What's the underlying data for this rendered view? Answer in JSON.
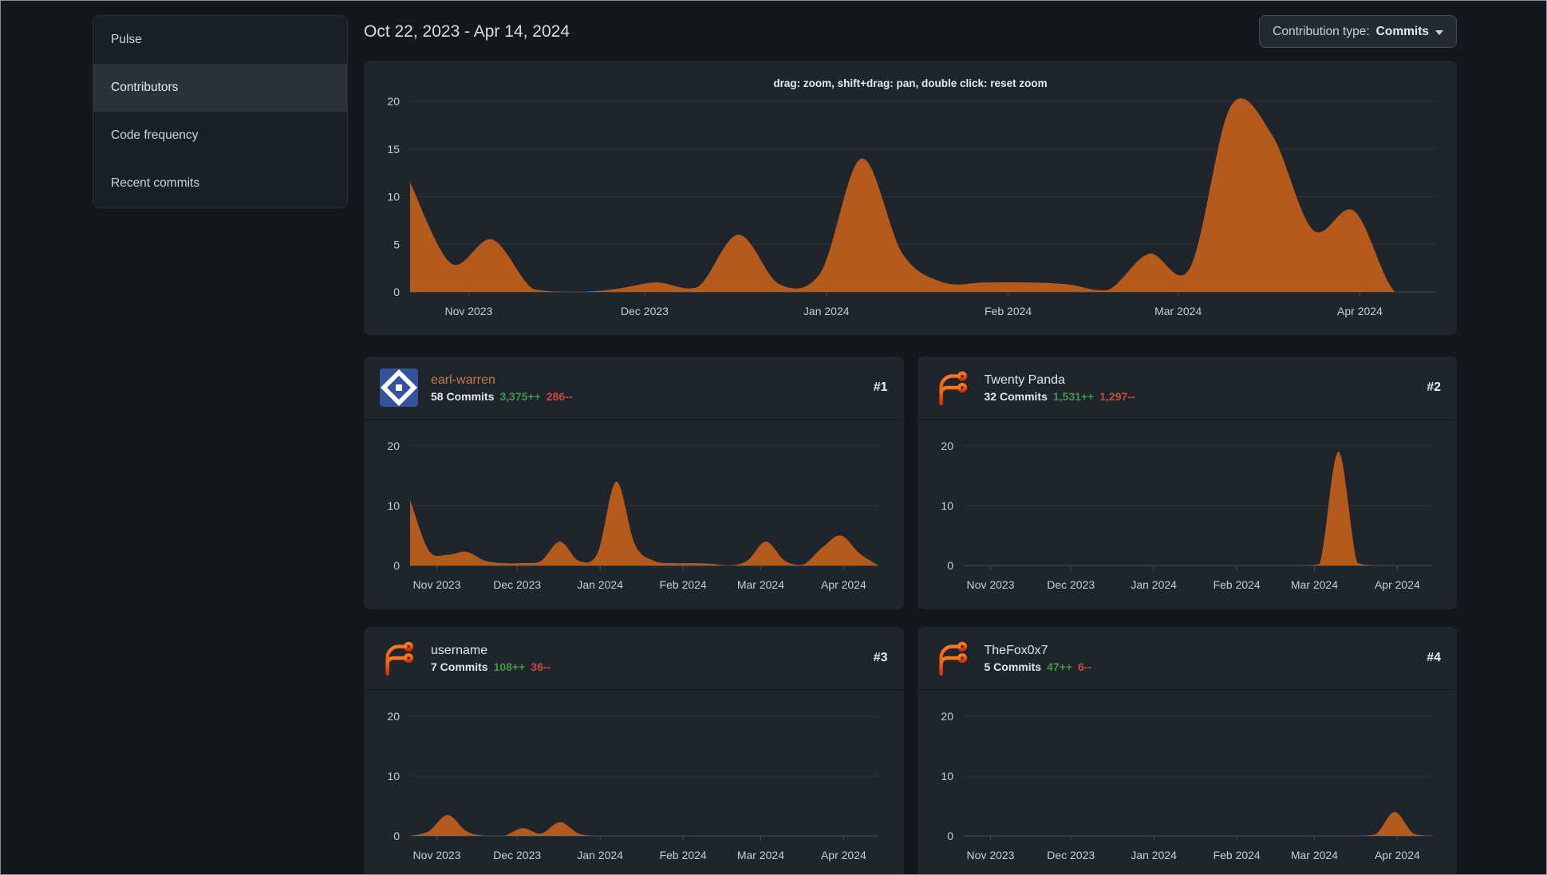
{
  "theme": {
    "page_bg": "#14171c",
    "panel_bg": "#191f26",
    "card_bg": "#1f252d",
    "selected_bg": "#2a323c",
    "border": "#262e38",
    "text": "#ccd3da",
    "heading_text": "#d6dce3",
    "area_fill": "#b45a1d",
    "grid_line": "#2c333c",
    "axis_line": "#434b55",
    "axis_text": "#c6cdd4",
    "additions_green": "#419744",
    "deletions_red": "#c7493f",
    "accent_orange_name": "#c87a41"
  },
  "sidebar": {
    "items": [
      {
        "label": "Pulse",
        "active": false
      },
      {
        "label": "Contributors",
        "active": true
      },
      {
        "label": "Code frequency",
        "active": false
      },
      {
        "label": "Recent commits",
        "active": false
      }
    ]
  },
  "header": {
    "date_range": "Oct 22, 2023 - Apr 14, 2024",
    "contribution_type_label": "Contribution type:",
    "contribution_type_value": "Commits"
  },
  "contributors": [
    {
      "name": "earl-warren",
      "commits": "58 Commits",
      "additions": "3,375++",
      "deletions": "286--",
      "rank": "#1",
      "avatar": "identicon-blue"
    },
    {
      "name": "Twenty Panda",
      "commits": "32 Commits",
      "additions": "1,531++",
      "deletions": "1,297--",
      "rank": "#2",
      "avatar": "forgejo-logo"
    },
    {
      "name": "username",
      "commits": "7 Commits",
      "additions": "108++",
      "deletions": "36--",
      "rank": "#3",
      "avatar": "forgejo-logo"
    },
    {
      "name": "TheFox0x7",
      "commits": "5 Commits",
      "additions": "47++",
      "deletions": "6--",
      "rank": "#4",
      "avatar": "forgejo-logo"
    }
  ],
  "chart_data": {
    "type": "area",
    "hint": "drag: zoom, shift+drag: pan, double click: reset zoom",
    "x_range_label": "Oct 22, 2023 - Apr 14, 2024",
    "point_interval": "weekly",
    "grid": true,
    "legend": false,
    "x_ticks": [
      {
        "frac": 0.0571,
        "label": "Nov 2023"
      },
      {
        "frac": 0.2286,
        "label": "Dec 2023"
      },
      {
        "frac": 0.4057,
        "label": "Jan 2024"
      },
      {
        "frac": 0.5829,
        "label": "Feb 2024"
      },
      {
        "frac": 0.7486,
        "label": "Mar 2024"
      },
      {
        "frac": 0.9257,
        "label": "Apr 2024"
      }
    ],
    "charts": [
      {
        "name": "overall-commits",
        "ylim": [
          0,
          20
        ],
        "yticks": [
          0,
          5,
          10,
          15,
          20
        ],
        "values": [
          11.5,
          3,
          5.5,
          0.3,
          0,
          0.3,
          1,
          0.5,
          6,
          0.8,
          2,
          14,
          4,
          1,
          1,
          1,
          0.8,
          0.2,
          4,
          2.5,
          19.5,
          16.5,
          6.5,
          8.5,
          0,
          0
        ]
      },
      {
        "name": "earl-warren-commits",
        "ylim": [
          0,
          20
        ],
        "yticks": [
          0,
          10,
          20
        ],
        "values": [
          11,
          2.5,
          1.8,
          2.3,
          0.8,
          0.4,
          0.4,
          0.8,
          4,
          0.8,
          2,
          14,
          3.5,
          0.8,
          0.4,
          0.4,
          0.3,
          0,
          0.8,
          4,
          0.8,
          0.2,
          3,
          5,
          2,
          0
        ]
      },
      {
        "name": "twenty-panda-commits",
        "ylim": [
          0,
          20
        ],
        "yticks": [
          0,
          10,
          20
        ],
        "values": [
          0,
          0,
          0,
          0,
          0,
          0,
          0,
          0,
          0,
          0,
          0,
          0,
          0,
          0,
          0,
          0,
          0,
          0,
          0,
          0.3,
          19,
          0.5,
          0,
          0,
          0,
          0
        ]
      },
      {
        "name": "username-commits",
        "ylim": [
          0,
          20
        ],
        "yticks": [
          0,
          10,
          20
        ],
        "values": [
          0,
          0.8,
          3.5,
          0.8,
          0,
          0,
          1.3,
          0.4,
          2.3,
          0.4,
          0,
          0,
          0,
          0,
          0,
          0,
          0,
          0,
          0,
          0,
          0,
          0,
          0,
          0,
          0,
          0
        ]
      },
      {
        "name": "thefox0x7-commits",
        "ylim": [
          0,
          20
        ],
        "yticks": [
          0,
          10,
          20
        ],
        "values": [
          0,
          0,
          0,
          0,
          0,
          0,
          0,
          0,
          0,
          0,
          0,
          0,
          0,
          0,
          0,
          0,
          0,
          0,
          0,
          0,
          0,
          0,
          0.3,
          4,
          0.4,
          0
        ]
      }
    ]
  }
}
